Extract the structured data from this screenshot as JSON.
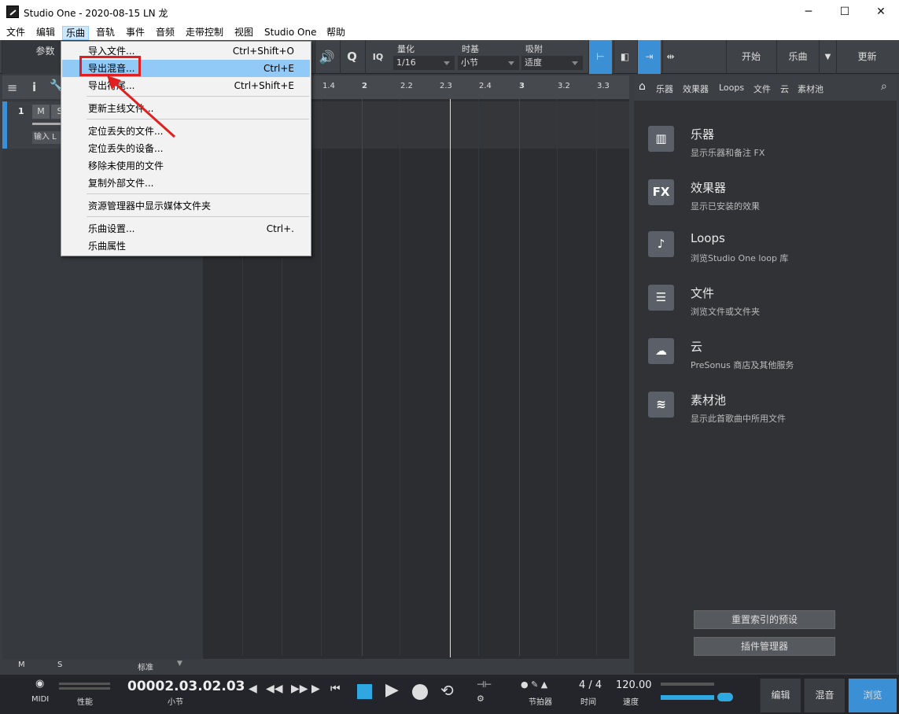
{
  "window": {
    "title": "Studio One - 2020-08-15 LN 龙",
    "minimize": "─",
    "maximize": "☐",
    "close": "✕"
  },
  "menubar": [
    "文件",
    "编辑",
    "乐曲",
    "音轨",
    "事件",
    "音频",
    "走带控制",
    "视图",
    "Studio One",
    "帮助"
  ],
  "dropdown": {
    "items": [
      {
        "label": "导入文件...",
        "shortcut": "Ctrl+Shift+O"
      },
      {
        "label": "导出混音...",
        "shortcut": "Ctrl+E",
        "highlighted": true
      },
      {
        "label": "导出符尾...",
        "shortcut": "Ctrl+Shift+E"
      },
      {
        "label": "更新主线文件...",
        "shortcut": ""
      },
      {
        "label": "定位丢失的文件...",
        "shortcut": ""
      },
      {
        "label": "定位丢失的设备...",
        "shortcut": ""
      },
      {
        "label": "移除未使用的文件",
        "shortcut": ""
      },
      {
        "label": "复制外部文件...",
        "shortcut": ""
      },
      {
        "label": "资源管理器中显示媒体文件夹",
        "shortcut": ""
      },
      {
        "label": "乐曲设置...",
        "shortcut": "Ctrl+."
      },
      {
        "label": "乐曲属性",
        "shortcut": ""
      }
    ]
  },
  "toolbar": {
    "params_label": "参数",
    "quantize_label": "量化",
    "quantize_value": "1/16",
    "timebase_label": "时基",
    "timebase_value": "小节",
    "snap_label": "吸附",
    "snap_value": "适度",
    "iq": "IQ",
    "q": "Q",
    "start": "开始",
    "song": "乐曲",
    "update": "更新"
  },
  "track": {
    "number": "1",
    "mute": "M",
    "solo": "S",
    "input": "输入 L"
  },
  "ruler": [
    "1.4",
    "2",
    "2.2",
    "2.3",
    "2.4",
    "3",
    "3.2",
    "3.3"
  ],
  "timeline_bottom": {
    "m": "M",
    "s": "S",
    "mode": "标准"
  },
  "browser": {
    "tabs": [
      "乐器",
      "效果器",
      "Loops",
      "文件",
      "云",
      "素材池"
    ],
    "items": [
      {
        "title": "乐器",
        "desc": "显示乐器和备注 FX",
        "icon": "piano-icon"
      },
      {
        "title": "效果器",
        "desc": "显示已安装的效果",
        "icon": "fx-icon"
      },
      {
        "title": "Loops",
        "desc": "浏览Studio One loop 库",
        "icon": "loops-icon"
      },
      {
        "title": "文件",
        "desc": "浏览文件或文件夹",
        "icon": "files-icon"
      },
      {
        "title": "云",
        "desc": "PreSonus 商店及其他服务",
        "icon": "cloud-icon"
      },
      {
        "title": "素材池",
        "desc": "显示此首歌曲中所用文件",
        "icon": "pool-icon"
      }
    ],
    "reindex": "重置索引的预设",
    "plugin_manager": "插件管理器"
  },
  "transport": {
    "midi": "MIDI",
    "performance": "性能",
    "position": "00002.03.02.03",
    "position_unit": "小节",
    "metronome": "节拍器",
    "signature": "4 / 4",
    "signature_label": "时间",
    "tempo": "120.00",
    "tempo_label": "速度",
    "edit": "编辑",
    "mix": "混音",
    "browse": "浏览"
  }
}
